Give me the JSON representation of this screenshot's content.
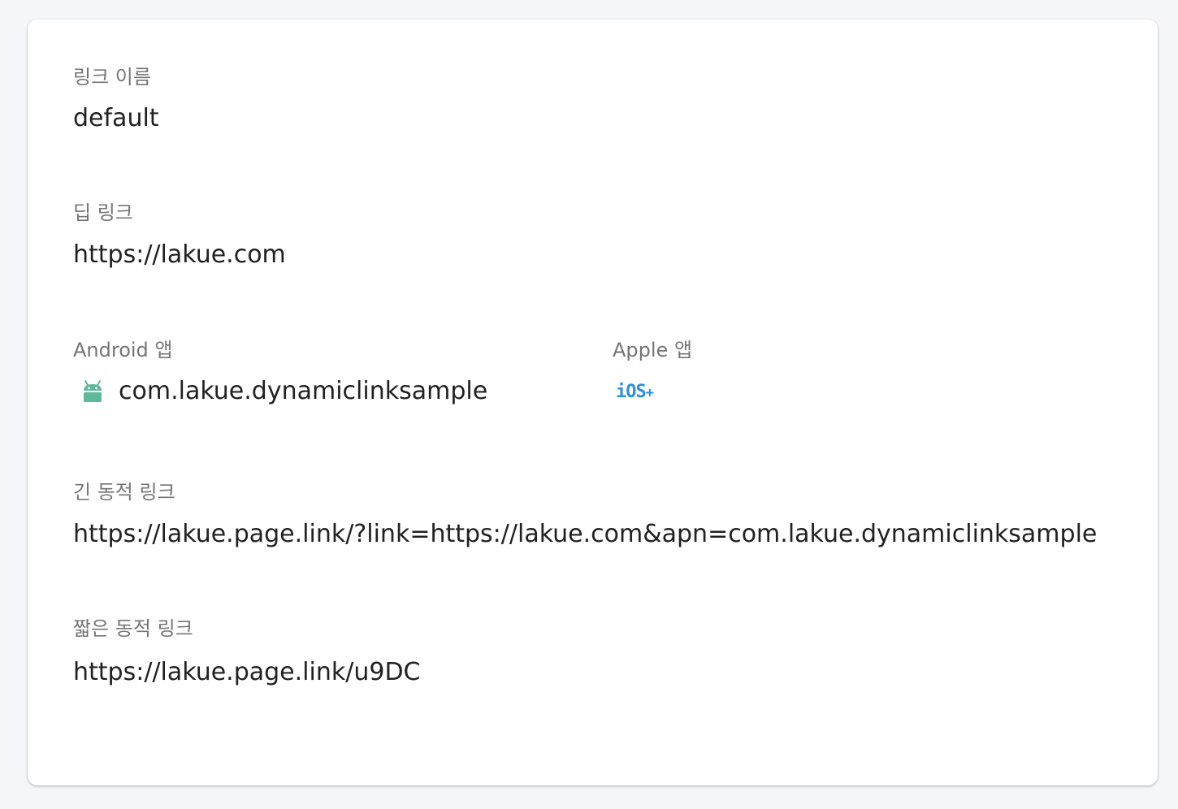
{
  "link_name": {
    "label": "링크 이름",
    "value": "default"
  },
  "deep_link": {
    "label": "딥 링크",
    "value": "https://lakue.com"
  },
  "android_app": {
    "label": "Android 앱",
    "icon": "android-icon",
    "icon_color": "#5fb89a",
    "value": "com.lakue.dynamiclinksample"
  },
  "apple_app": {
    "label": "Apple 앱",
    "badge_text": "iOS",
    "badge_suffix": "+",
    "badge_color": "#2e8ee0"
  },
  "long_dynamic_link": {
    "label": "긴 동적 링크",
    "value": "https://lakue.page.link/?link=https://lakue.com&apn=com.lakue.dynamiclinksample"
  },
  "short_dynamic_link": {
    "label": "짧은 동적 링크",
    "value": "https://lakue.page.link/u9DC"
  }
}
